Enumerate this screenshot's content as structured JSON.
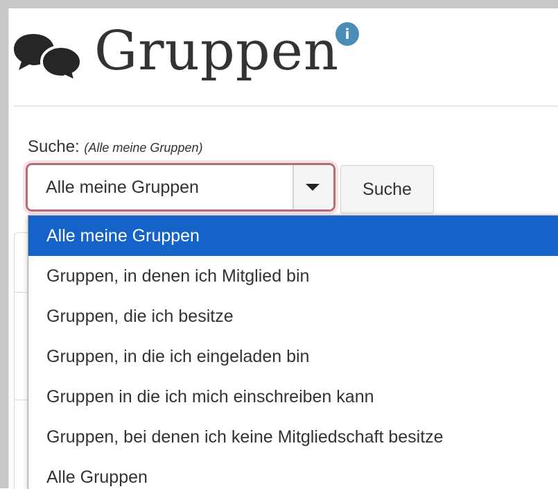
{
  "header": {
    "title": "Gruppen",
    "title_icon": "comments-icon",
    "info_icon_label": "i",
    "info_icon_color": "#4b8cb6"
  },
  "search": {
    "label": "Suche:",
    "hint": "(Alle meine Gruppen)",
    "selected_value": "Alle meine Gruppen",
    "button_label": "Suche"
  },
  "dropdown": {
    "options": [
      {
        "label": "Alle meine Gruppen",
        "selected": true
      },
      {
        "label": "Gruppen, in denen ich Mitglied bin",
        "selected": false
      },
      {
        "label": "Gruppen, die ich besitze",
        "selected": false
      },
      {
        "label": "Gruppen, in die ich eingeladen bin",
        "selected": false
      },
      {
        "label": "Gruppen in die ich mich einschreiben kann",
        "selected": false
      },
      {
        "label": "Gruppen, bei denen ich keine Mitgliedschaft besitze",
        "selected": false
      },
      {
        "label": "Alle Gruppen",
        "selected": false
      }
    ],
    "highlight_color": "#1563c8"
  },
  "colors": {
    "select_focus_border": "#b86c7a",
    "frame_border": "#c8c8c8"
  }
}
